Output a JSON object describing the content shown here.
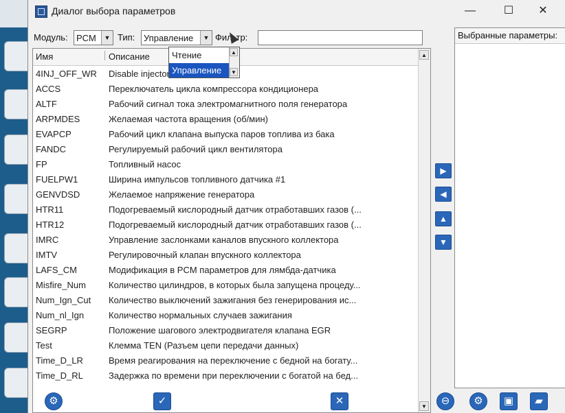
{
  "window": {
    "title": "Диалог выбора параметров",
    "minimize_glyph": "—",
    "maximize_glyph": "☐",
    "close_glyph": "✕"
  },
  "toolbar": {
    "module_label": "Модуль:",
    "module_value": "PCM",
    "type_label": "Тип:",
    "type_value": "Управление",
    "filter_label": "Фильтр:",
    "filter_value": ""
  },
  "dropdown": {
    "options": [
      "Чтение",
      "Управление"
    ],
    "selected": "Управление"
  },
  "list": {
    "columns": [
      "Имя",
      "Описание"
    ],
    "rows": [
      {
        "name": "4INJ_OFF_WR",
        "desc": "Disable injector"
      },
      {
        "name": "ACCS",
        "desc": "Переключатель цикла компрессора кондиционера"
      },
      {
        "name": "ALTF",
        "desc": "Рабочий сигнал тока электромагнитного поля генератора"
      },
      {
        "name": "ARPMDES",
        "desc": "Желаемая частота вращения (об/мин)"
      },
      {
        "name": "EVAPCP",
        "desc": "Рабочий цикл клапана выпуска паров топлива из бака"
      },
      {
        "name": "FANDC",
        "desc": "Регулируемый рабочий цикл вентилятора"
      },
      {
        "name": "FP",
        "desc": "Топливный насос"
      },
      {
        "name": "FUELPW1",
        "desc": "Ширина импульсов топливного датчика #1"
      },
      {
        "name": "GENVDSD",
        "desc": "Желаемое напряжение генератора"
      },
      {
        "name": "HTR11",
        "desc": "Подогреваемый кислородный датчик отработавших газов (..."
      },
      {
        "name": "HTR12",
        "desc": "Подогреваемый кислородный датчик отработавших газов (..."
      },
      {
        "name": "IMRC",
        "desc": "Управление заслонками каналов впускного коллектора"
      },
      {
        "name": "IMTV",
        "desc": "Регулировочный клапан впускного коллектора"
      },
      {
        "name": "LAFS_CM",
        "desc": "Модификация в PCM параметров для лямбда-датчика"
      },
      {
        "name": "Misfire_Num",
        "desc": "Количество цилиндров, в которых была запущена процеду..."
      },
      {
        "name": "Num_Ign_Cut",
        "desc": "Количество выключений зажигания без генерирования ис..."
      },
      {
        "name": "Num_nl_Ign",
        "desc": "Количество нормальных случаев зажигания"
      },
      {
        "name": "SEGRP",
        "desc": "Положение шагового электродвигателя клапана EGR"
      },
      {
        "name": "Test",
        "desc": "Клемма TEN (Разъем цепи передачи данных)"
      },
      {
        "name": "Time_D_LR",
        "desc": "Время реагирования на переключение с бедной на богату..."
      },
      {
        "name": "Time_D_RL",
        "desc": "Задержка по времени при переключении с богатой на бед..."
      }
    ]
  },
  "right_panel": {
    "header": "Выбранные параметры:"
  },
  "colors": {
    "accent": "#2a67b8",
    "selection": "#1a55c0"
  }
}
